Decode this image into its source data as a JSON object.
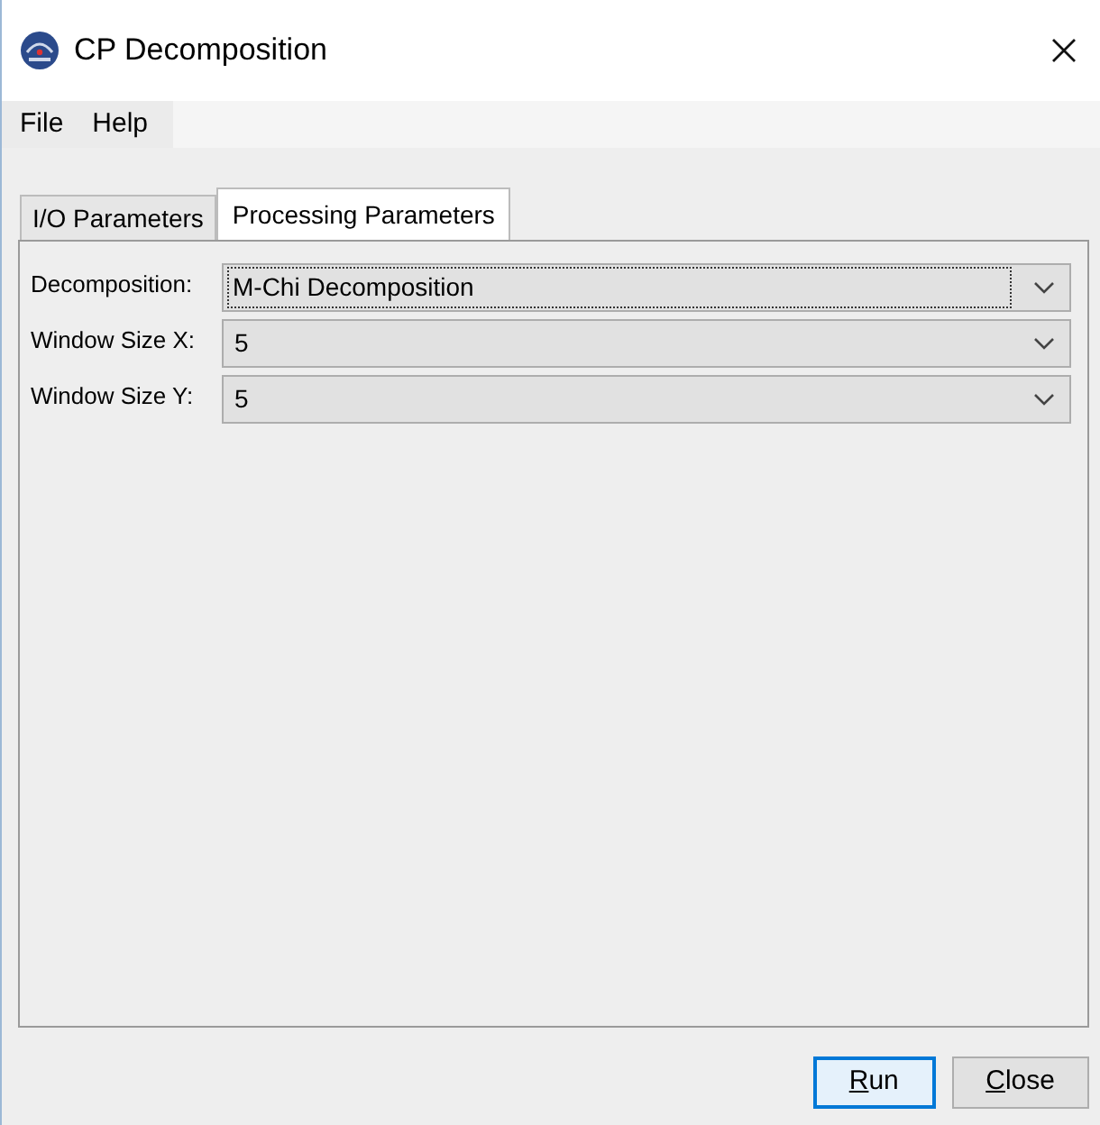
{
  "window": {
    "title": "CP Decomposition"
  },
  "menu": [
    "File",
    "Help"
  ],
  "tabs": [
    {
      "label": "I/O Parameters",
      "selected": false
    },
    {
      "label": "Processing Parameters",
      "selected": true
    }
  ],
  "fields": [
    {
      "label": "Decomposition:",
      "value": "M-Chi Decomposition",
      "focused": true
    },
    {
      "label": "Window Size X:",
      "value": "5",
      "focused": false
    },
    {
      "label": "Window Size Y:",
      "value": "5",
      "focused": false
    }
  ],
  "buttons": [
    {
      "label": "Run",
      "default": true,
      "underline_first": true
    },
    {
      "label": "Close",
      "default": false,
      "underline_first": true
    }
  ]
}
